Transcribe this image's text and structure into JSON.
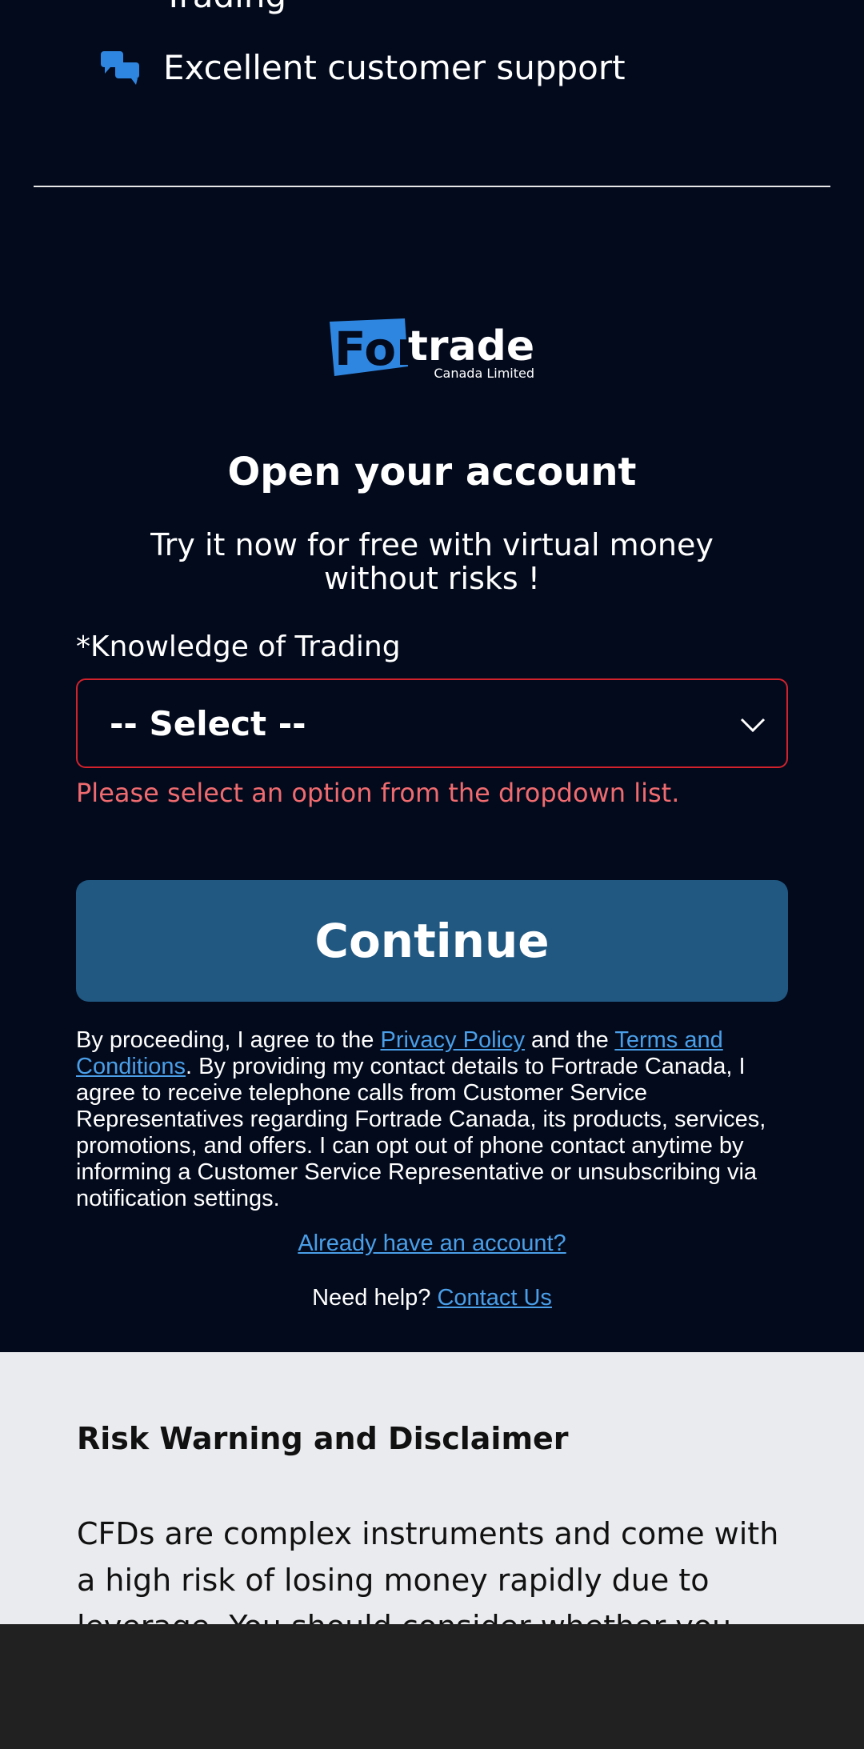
{
  "features": {
    "partial_label": "Trading",
    "support_label": "Excellent customer support"
  },
  "logo": {
    "brand_left": "For",
    "brand_right": "trade",
    "subline": "Canada Limited"
  },
  "form": {
    "title": "Open your account",
    "subtitle": "Try it now for free with virtual money without risks !",
    "knowledge_label": "*Knowledge of Trading",
    "select_value": "-- Select --",
    "error_text": "Please select an option from the dropdown list.",
    "continue_label": "Continue"
  },
  "legal": {
    "intro": "By proceeding, I agree to the ",
    "privacy_link": "Privacy Policy",
    "and_the": " and the ",
    "terms_link": "Terms and Conditions",
    "rest": ". By providing my contact details to Fortrade Canada, I agree to receive telephone calls from Customer Service Representatives regarding Fortrade Canada, its products, services, promotions, and offers. I can opt out of phone contact anytime by informing a Customer Service Representative or unsubscribing via notification settings."
  },
  "login_link": "Already have an account?",
  "help": {
    "prefix": "Need help? ",
    "contact_link": "Contact Us"
  },
  "risk": {
    "title": "Risk Warning and Disclaimer",
    "body": "CFDs are complex instruments and come with a high risk of losing money rapidly due to leverage. You should consider whether you understand"
  },
  "colors": {
    "background": "#030a1c",
    "accent_blue": "#2f86e0",
    "button": "#205882",
    "error": "#ef6b6f",
    "link": "#4a9fe8"
  }
}
